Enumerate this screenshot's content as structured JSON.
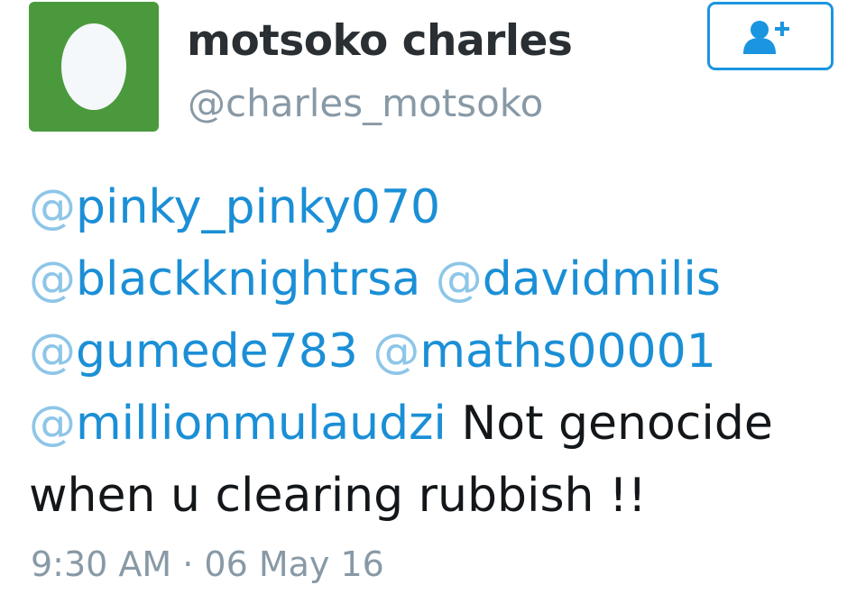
{
  "author": {
    "display_name": "motsoko charles",
    "handle": "@charles_motsoko",
    "avatar_icon": "default-egg-avatar",
    "avatar_color": "#4a9a3d"
  },
  "follow_button": {
    "icon": "follow-user-plus-icon",
    "color": "#1b95e0"
  },
  "tweet": {
    "mentions": [
      {
        "at": "@",
        "name": "pinky_pinky070"
      },
      {
        "at": "@",
        "name": "blackknightrsa"
      },
      {
        "at": "@",
        "name": "davidmilis"
      },
      {
        "at": "@",
        "name": "gumede783"
      },
      {
        "at": "@",
        "name": "maths00001"
      },
      {
        "at": "@",
        "name": "millionmulaudzi"
      }
    ],
    "text_part1": "Not genocide",
    "text_part2": "when u clearing rubbish !!",
    "mention_color": "#1b8fd6"
  },
  "timestamp": "9:30 AM · 06 May 16"
}
